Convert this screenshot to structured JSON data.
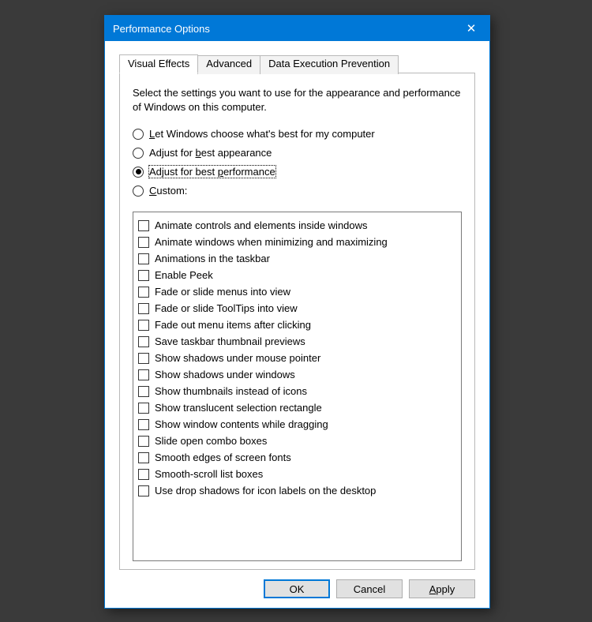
{
  "window": {
    "title": "Performance Options",
    "close_label": "✕"
  },
  "tabs": [
    {
      "label": "Visual Effects",
      "active": true
    },
    {
      "label": "Advanced",
      "active": false
    },
    {
      "label": "Data Execution Prevention",
      "active": false
    }
  ],
  "intro": "Select the settings you want to use for the appearance and performance of Windows on this computer.",
  "radios": [
    {
      "id": "let-windows-choose",
      "label_pre": "",
      "label_u": "L",
      "label_post": "et Windows choose what's best for my computer",
      "checked": false,
      "focused": false
    },
    {
      "id": "best-appearance",
      "label_pre": "Adjust for ",
      "label_u": "b",
      "label_post": "est appearance",
      "checked": false,
      "focused": false
    },
    {
      "id": "best-performance",
      "label_pre": "Adjust for best ",
      "label_u": "p",
      "label_post": "erformance",
      "checked": true,
      "focused": true
    },
    {
      "id": "custom",
      "label_pre": "",
      "label_u": "C",
      "label_post": "ustom:",
      "checked": false,
      "focused": false
    }
  ],
  "items": [
    {
      "label": "Animate controls and elements inside windows",
      "checked": false
    },
    {
      "label": "Animate windows when minimizing and maximizing",
      "checked": false
    },
    {
      "label": "Animations in the taskbar",
      "checked": false
    },
    {
      "label": "Enable Peek",
      "checked": false
    },
    {
      "label": "Fade or slide menus into view",
      "checked": false
    },
    {
      "label": "Fade or slide ToolTips into view",
      "checked": false
    },
    {
      "label": "Fade out menu items after clicking",
      "checked": false
    },
    {
      "label": "Save taskbar thumbnail previews",
      "checked": false
    },
    {
      "label": "Show shadows under mouse pointer",
      "checked": false
    },
    {
      "label": "Show shadows under windows",
      "checked": false
    },
    {
      "label": "Show thumbnails instead of icons",
      "checked": false
    },
    {
      "label": "Show translucent selection rectangle",
      "checked": false
    },
    {
      "label": "Show window contents while dragging",
      "checked": false
    },
    {
      "label": "Slide open combo boxes",
      "checked": false
    },
    {
      "label": "Smooth edges of screen fonts",
      "checked": false
    },
    {
      "label": "Smooth-scroll list boxes",
      "checked": false
    },
    {
      "label": "Use drop shadows for icon labels on the desktop",
      "checked": false
    }
  ],
  "buttons": {
    "ok": {
      "label": "OK"
    },
    "cancel": {
      "label": "Cancel"
    },
    "apply": {
      "label_u": "A",
      "label_post": "pply"
    }
  }
}
